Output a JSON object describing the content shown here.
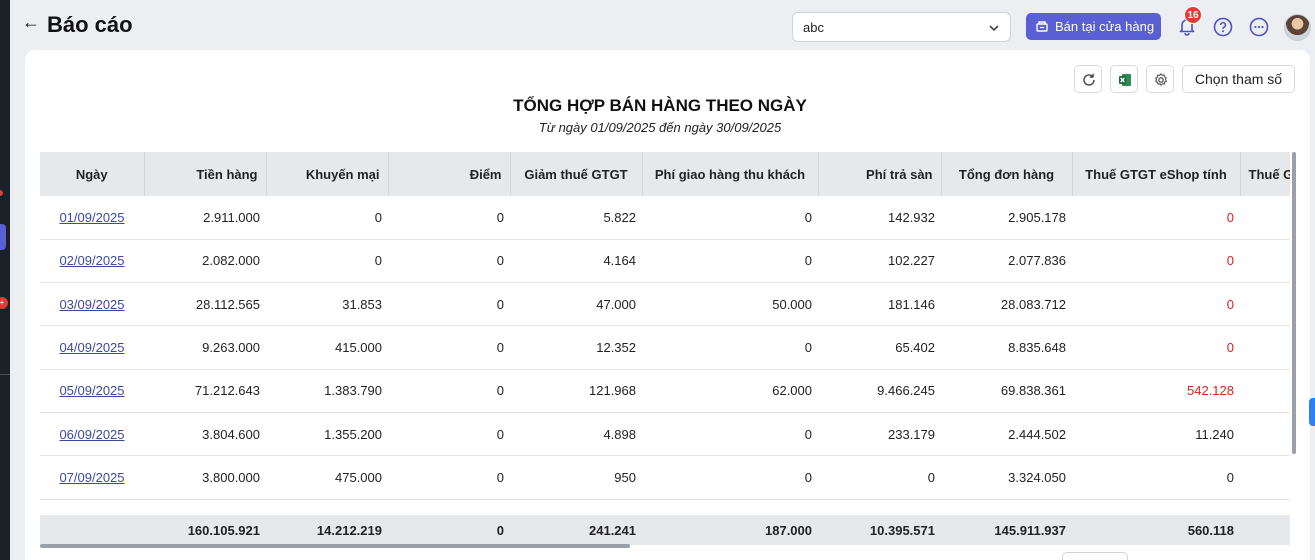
{
  "header": {
    "back_icon": "arrow-left-icon",
    "title": "Báo cáo"
  },
  "store_select": {
    "value": "abc"
  },
  "sell_button": {
    "label": "Bán tại cửa hàng"
  },
  "notifications": {
    "count": "16"
  },
  "toolbar": {
    "choose_params_label": "Chọn tham số"
  },
  "report": {
    "title": "TỔNG HỢP BÁN HÀNG THEO NGÀY",
    "subtitle": "Từ ngày 01/09/2025 đến ngày 30/09/2025"
  },
  "table": {
    "columns": [
      "Ngày",
      "Tiền hàng",
      "Khuyến mại",
      "Điểm",
      "Giảm thuế GTGT",
      "Phí giao hàng thu khách",
      "Phí trả sàn",
      "Tổng đơn hàng",
      "Thuế GTGT eShop tính",
      "Thuế GTGT"
    ],
    "rows": [
      [
        "01/09/2025",
        "2.911.000",
        "0",
        "0",
        "5.822",
        "0",
        "142.932",
        "2.905.178",
        "0",
        ""
      ],
      [
        "02/09/2025",
        "2.082.000",
        "0",
        "0",
        "4.164",
        "0",
        "102.227",
        "2.077.836",
        "0",
        ""
      ],
      [
        "03/09/2025",
        "28.112.565",
        "31.853",
        "0",
        "47.000",
        "50.000",
        "181.146",
        "28.083.712",
        "0",
        ""
      ],
      [
        "04/09/2025",
        "9.263.000",
        "415.000",
        "0",
        "12.352",
        "0",
        "65.402",
        "8.835.648",
        "0",
        ""
      ],
      [
        "05/09/2025",
        "71.212.643",
        "1.383.790",
        "0",
        "121.968",
        "62.000",
        "9.466.245",
        "69.838.361",
        "542.128",
        ""
      ],
      [
        "06/09/2025",
        "3.804.600",
        "1.355.200",
        "0",
        "4.898",
        "0",
        "233.179",
        "2.444.502",
        "11.240",
        ""
      ],
      [
        "07/09/2025",
        "3.800.000",
        "475.000",
        "0",
        "950",
        "0",
        "0",
        "3.324.050",
        "0",
        ""
      ]
    ],
    "red_cells": [
      [
        0,
        8
      ],
      [
        1,
        8
      ],
      [
        2,
        8
      ],
      [
        3,
        8
      ],
      [
        4,
        8
      ]
    ],
    "totals": [
      "",
      "160.105.921",
      "14.212.219",
      "0",
      "241.241",
      "187.000",
      "10.395.571",
      "145.911.937",
      "560.118",
      ""
    ]
  }
}
